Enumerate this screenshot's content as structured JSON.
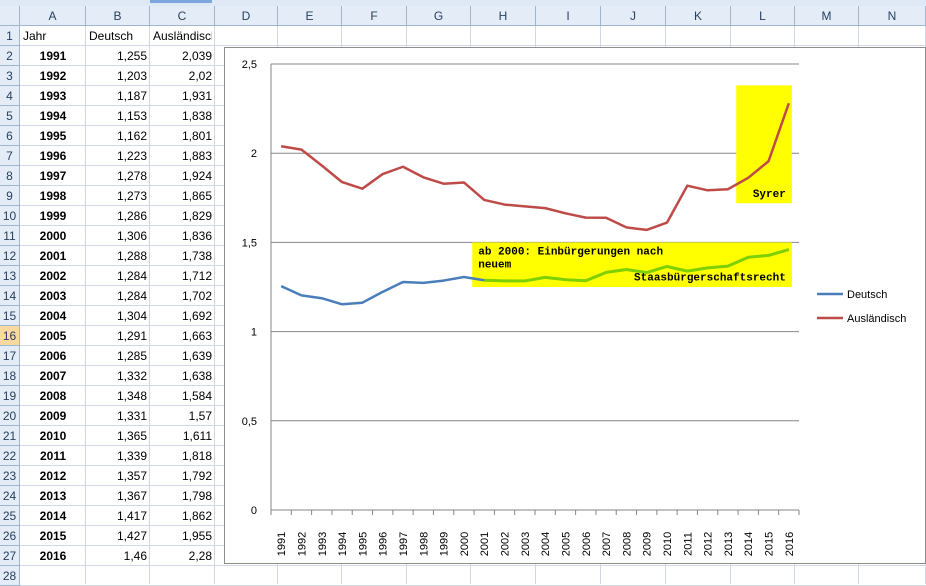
{
  "sheet": {
    "columns": [
      "A",
      "B",
      "C",
      "D",
      "E",
      "F",
      "G",
      "H",
      "I",
      "J",
      "K",
      "L",
      "M",
      "N"
    ],
    "selected_row": 16,
    "rows": [
      [
        "Jahr",
        "Deutsch",
        "Ausländisch"
      ],
      [
        "1991",
        "1,255",
        "2,039"
      ],
      [
        "1992",
        "1,203",
        "2,02"
      ],
      [
        "1993",
        "1,187",
        "1,931"
      ],
      [
        "1994",
        "1,153",
        "1,838"
      ],
      [
        "1995",
        "1,162",
        "1,801"
      ],
      [
        "1996",
        "1,223",
        "1,883"
      ],
      [
        "1997",
        "1,278",
        "1,924"
      ],
      [
        "1998",
        "1,273",
        "1,865"
      ],
      [
        "1999",
        "1,286",
        "1,829"
      ],
      [
        "2000",
        "1,306",
        "1,836"
      ],
      [
        "2001",
        "1,288",
        "1,738"
      ],
      [
        "2002",
        "1,284",
        "1,712"
      ],
      [
        "2003",
        "1,284",
        "1,702"
      ],
      [
        "2004",
        "1,304",
        "1,692"
      ],
      [
        "2005",
        "1,291",
        "1,663"
      ],
      [
        "2006",
        "1,285",
        "1,639"
      ],
      [
        "2007",
        "1,332",
        "1,638"
      ],
      [
        "2008",
        "1,348",
        "1,584"
      ],
      [
        "2009",
        "1,331",
        "1,57"
      ],
      [
        "2010",
        "1,365",
        "1,611"
      ],
      [
        "2011",
        "1,339",
        "1,818"
      ],
      [
        "2012",
        "1,357",
        "1,792"
      ],
      [
        "2013",
        "1,367",
        "1,798"
      ],
      [
        "2014",
        "1,417",
        "1,862"
      ],
      [
        "2015",
        "1,427",
        "1,955"
      ],
      [
        "2016",
        "1,46",
        "2,28"
      ],
      [
        "",
        "",
        ""
      ]
    ]
  },
  "chart_data": {
    "type": "line",
    "x": [
      "1991",
      "1992",
      "1993",
      "1994",
      "1995",
      "1996",
      "1997",
      "1998",
      "1999",
      "2000",
      "2001",
      "2002",
      "2003",
      "2004",
      "2005",
      "2006",
      "2007",
      "2008",
      "2009",
      "2010",
      "2011",
      "2012",
      "2013",
      "2014",
      "2015",
      "2016"
    ],
    "series": [
      {
        "name": "Deutsch",
        "color": "#4a7ebb",
        "values": [
          1.255,
          1.203,
          1.187,
          1.153,
          1.162,
          1.223,
          1.278,
          1.273,
          1.286,
          1.306,
          1.288,
          1.284,
          1.284,
          1.304,
          1.291,
          1.285,
          1.332,
          1.348,
          1.331,
          1.365,
          1.339,
          1.357,
          1.367,
          1.417,
          1.427,
          1.46
        ]
      },
      {
        "name": "Ausländisch",
        "color": "#be4b48",
        "values": [
          2.039,
          2.02,
          1.931,
          1.838,
          1.801,
          1.883,
          1.924,
          1.865,
          1.829,
          1.836,
          1.738,
          1.712,
          1.702,
          1.692,
          1.663,
          1.639,
          1.638,
          1.584,
          1.57,
          1.611,
          1.818,
          1.792,
          1.798,
          1.862,
          1.955,
          2.28
        ]
      }
    ],
    "highlight_series": {
      "color": "#7fd000",
      "from": "2001",
      "to": "2016"
    },
    "ylim": [
      0,
      2.5
    ],
    "yticks": [
      "0",
      "0,5",
      "1",
      "1,5",
      "2",
      "2,5"
    ],
    "grid": true,
    "legend": "right",
    "annotations": [
      {
        "lines": [
          "ab 2000: Einbürgerungen nach",
          "neuem",
          "Staasbürgerschaftsrecht"
        ],
        "fill": "#ffff00",
        "from": "2001",
        "to": "2016",
        "ymin": 1.25,
        "ymax": 1.5
      },
      {
        "lines": [
          "Syrer"
        ],
        "fill": "#ffff00",
        "from": "2014",
        "to": "2016",
        "ymin": 1.72,
        "ymax": 2.38
      }
    ]
  }
}
